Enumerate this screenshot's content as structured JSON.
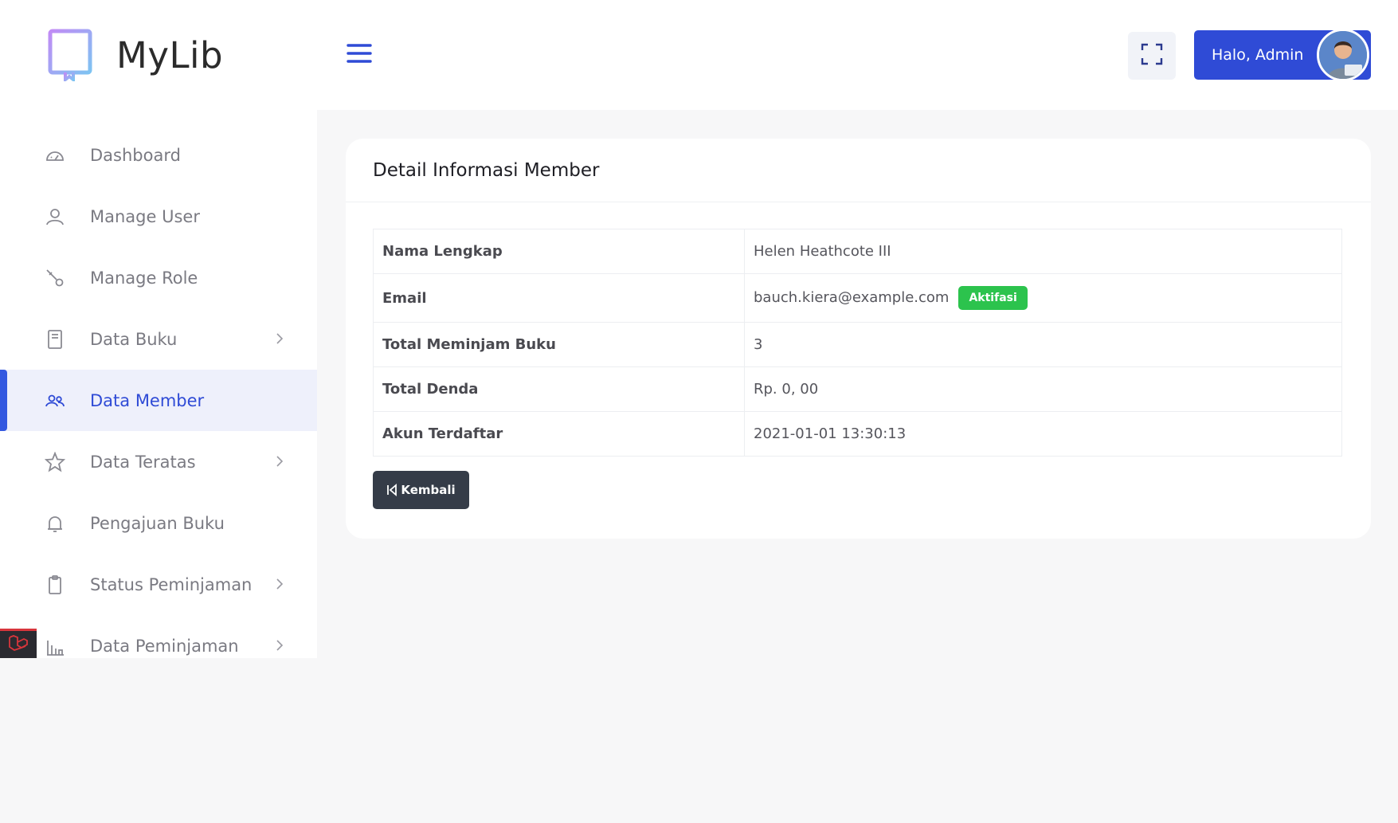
{
  "brand": {
    "name": "MyLib",
    "logo_icon": "book-logo-icon"
  },
  "sidebar": {
    "items": [
      {
        "label": "Dashboard",
        "icon": "speedometer-icon",
        "has_submenu": false,
        "active": false
      },
      {
        "label": "Manage User",
        "icon": "user-icon",
        "has_submenu": false,
        "active": false
      },
      {
        "label": "Manage Role",
        "icon": "key-icon",
        "has_submenu": false,
        "active": false
      },
      {
        "label": "Data Buku",
        "icon": "book-icon",
        "has_submenu": true,
        "active": false
      },
      {
        "label": "Data Member",
        "icon": "users-icon",
        "has_submenu": false,
        "active": true
      },
      {
        "label": "Data Teratas",
        "icon": "star-icon",
        "has_submenu": true,
        "active": false
      },
      {
        "label": "Pengajuan Buku",
        "icon": "bell-icon",
        "has_submenu": false,
        "active": false
      },
      {
        "label": "Status Peminjaman",
        "icon": "clipboard-icon",
        "has_submenu": true,
        "active": false
      },
      {
        "label": "Data Peminjaman",
        "icon": "bar-chart-icon",
        "has_submenu": true,
        "active": false
      }
    ]
  },
  "topbar": {
    "menu_toggle_icon": "hamburger-icon",
    "fullscreen_icon": "fullscreen-icon",
    "user_greeting": "Halo, Admin",
    "avatar_icon": "user-avatar"
  },
  "card": {
    "title": "Detail Informasi Member",
    "rows": [
      {
        "key": "Nama Lengkap",
        "value": "Helen Heathcote III"
      },
      {
        "key": "Email",
        "value": "bauch.kiera@example.com",
        "badge": "Aktifasi"
      },
      {
        "key": "Total Meminjam Buku",
        "value": "3"
      },
      {
        "key": "Total Denda",
        "value": "Rp. 0, 00"
      },
      {
        "key": "Akun Terdaftar",
        "value": "2021-01-01 13:30:13"
      }
    ],
    "back_button": "Kembali"
  },
  "colors": {
    "accent": "#2f4bd6",
    "active_bg": "#eef0fb",
    "badge_green": "#2cc34d",
    "back_button_bg": "#353c48",
    "laravel_red": "#d8363c"
  }
}
